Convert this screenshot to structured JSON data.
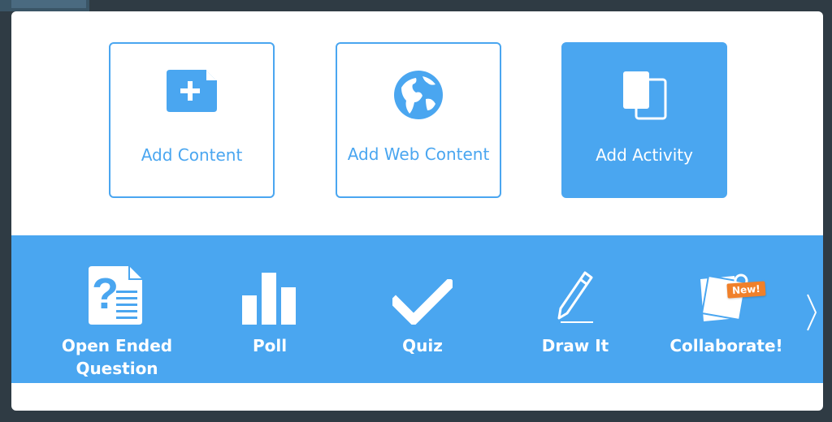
{
  "cards": [
    {
      "label": "Add Content",
      "icon": "add-file-icon"
    },
    {
      "label": "Add Web Content",
      "icon": "globe-icon"
    },
    {
      "label": "Add Activity",
      "icon": "activity-pages-icon"
    }
  ],
  "activities": [
    {
      "label": "Open Ended Question",
      "icon": "question-document-icon"
    },
    {
      "label": "Poll",
      "icon": "bar-chart-icon"
    },
    {
      "label": "Quiz",
      "icon": "checkmark-icon"
    },
    {
      "label": "Draw It",
      "icon": "pencil-icon"
    },
    {
      "label": "Collaborate!",
      "icon": "pinned-notes-icon"
    }
  ],
  "badge": "New!",
  "colors": {
    "accent": "#4aa6f0",
    "badge": "#f0802a",
    "backdrop": "#2f3b44"
  }
}
